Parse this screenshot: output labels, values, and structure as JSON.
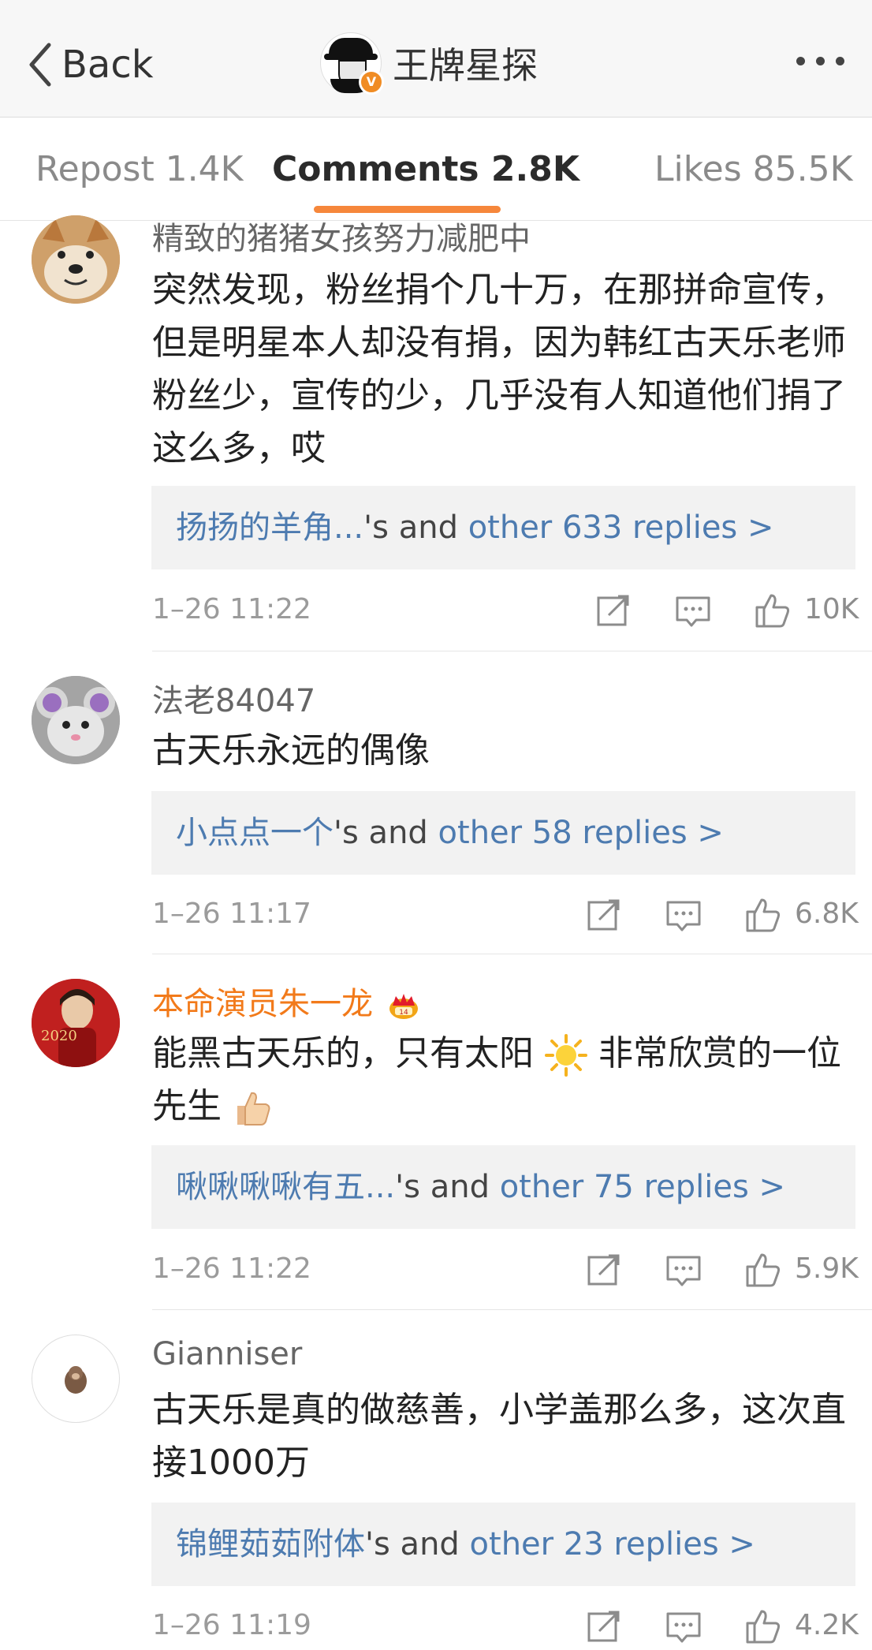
{
  "nav": {
    "back_label": "Back",
    "title": "王牌星探",
    "verified_badge": "V"
  },
  "tabs": [
    {
      "label": "Repost 1.4K",
      "active": false
    },
    {
      "label": "Comments 2.8K",
      "active": true
    },
    {
      "label": "Likes 85.5K",
      "active": false
    }
  ],
  "colors": {
    "accent": "#f6873b",
    "link": "#4d7bb0",
    "vip_name": "#f27a1a"
  },
  "comments": [
    {
      "username": "精致的猪猪女孩努力减肥中",
      "avatar_icon": "shiba-dog-avatar",
      "text": "突然发现，粉丝捐个几十万，在那拼命宣传，但是明星本人却没有捐，因为韩红古天乐老师粉丝少，宣传的少，几乎没有人知道他们捐了这么多，哎",
      "reply_user": "扬扬的羊角...",
      "reply_mid": "'s and ",
      "reply_link": "other 633 replies >",
      "time": "1–26 11:22",
      "likes": "10K"
    },
    {
      "username": "法老84047",
      "avatar_icon": "mouse-avatar",
      "text": "古天乐永远的偶像",
      "reply_user": "小点点一个",
      "reply_mid": "'s and ",
      "reply_link": "other 58 replies >",
      "time": "1–26 11:17",
      "likes": "6.8K"
    },
    {
      "username": "本命演员朱一龙",
      "avatar_icon": "red-2020-avatar",
      "avatar_text": "2020",
      "text_part1": "能黑古天乐的，只有太阳",
      "text_part2": " 非常欣赏的一位先生",
      "reply_user": "啾啾啾啾有五...",
      "reply_mid": "'s and ",
      "reply_link": "other 75 replies >",
      "time": "1–26 11:22",
      "likes": "5.9K"
    },
    {
      "username": "Gianniser",
      "avatar_icon": "monkey-avatar",
      "text": "古天乐是真的做慈善，小学盖那么多，这次直接1000万",
      "reply_user": "锦鲤茹茹附体",
      "reply_mid": "'s and ",
      "reply_link": "other 23 replies >",
      "time": "1–26 11:19",
      "likes": "4.2K"
    }
  ]
}
